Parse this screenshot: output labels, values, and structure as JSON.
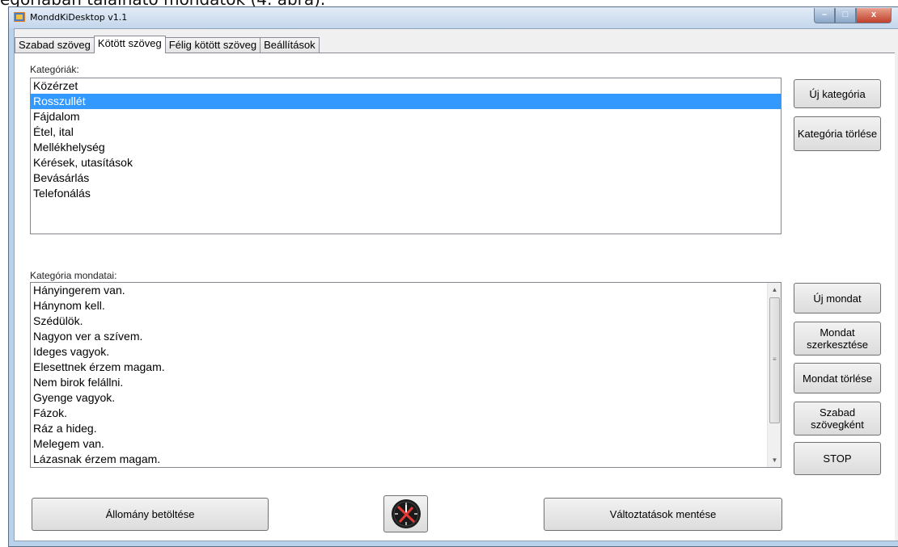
{
  "document_caption": "egóriában található mondatok (4. ábra).",
  "window": {
    "title": "MonddKiDesktop v1.1",
    "app_icon": "app-icon",
    "controls": {
      "minimize": "–",
      "maximize": "□",
      "close": "x"
    }
  },
  "tabs": [
    {
      "label": "Szabad szöveg",
      "active": false
    },
    {
      "label": "Kötött szöveg",
      "active": true
    },
    {
      "label": "Félig kötött szöveg",
      "active": false
    },
    {
      "label": "Beállítások",
      "active": false
    }
  ],
  "categories": {
    "label": "Kategóriák:",
    "items": [
      "Közérzet",
      "Rosszullét",
      "Fájdalom",
      "Étel, ital",
      "Mellékhelység",
      "Kérések, utasítások",
      "Bevásárlás",
      "Telefonálás"
    ],
    "selected_index": 1
  },
  "category_buttons": {
    "new_category": "Új kategória",
    "delete_category": "Kategória törlése"
  },
  "sentences": {
    "label": "Kategória mondatai:",
    "items": [
      "Hányingerem van.",
      "Hánynom kell.",
      "Szédülök.",
      "Nagyon ver a szívem.",
      "Ideges vagyok.",
      "Elesettnek érzem magam.",
      "Nem birok felállni.",
      "Gyenge vagyok.",
      "Fázok.",
      "Ráz a hideg.",
      "Melegem van.",
      "Lázasnak érzem magam."
    ]
  },
  "sentence_buttons": {
    "new_sentence": "Új mondat",
    "edit_sentence": "Mondat szerkesztése",
    "delete_sentence": "Mondat törlése",
    "as_free_text": "Szabad szövegként",
    "stop": "STOP"
  },
  "bottom_buttons": {
    "load_file": "Állomány betöltése",
    "clock_icon": "clock-icon",
    "save_changes": "Változtatások mentése"
  },
  "colors": {
    "selection": "#3399ff",
    "clock_hands": "#e53935"
  }
}
